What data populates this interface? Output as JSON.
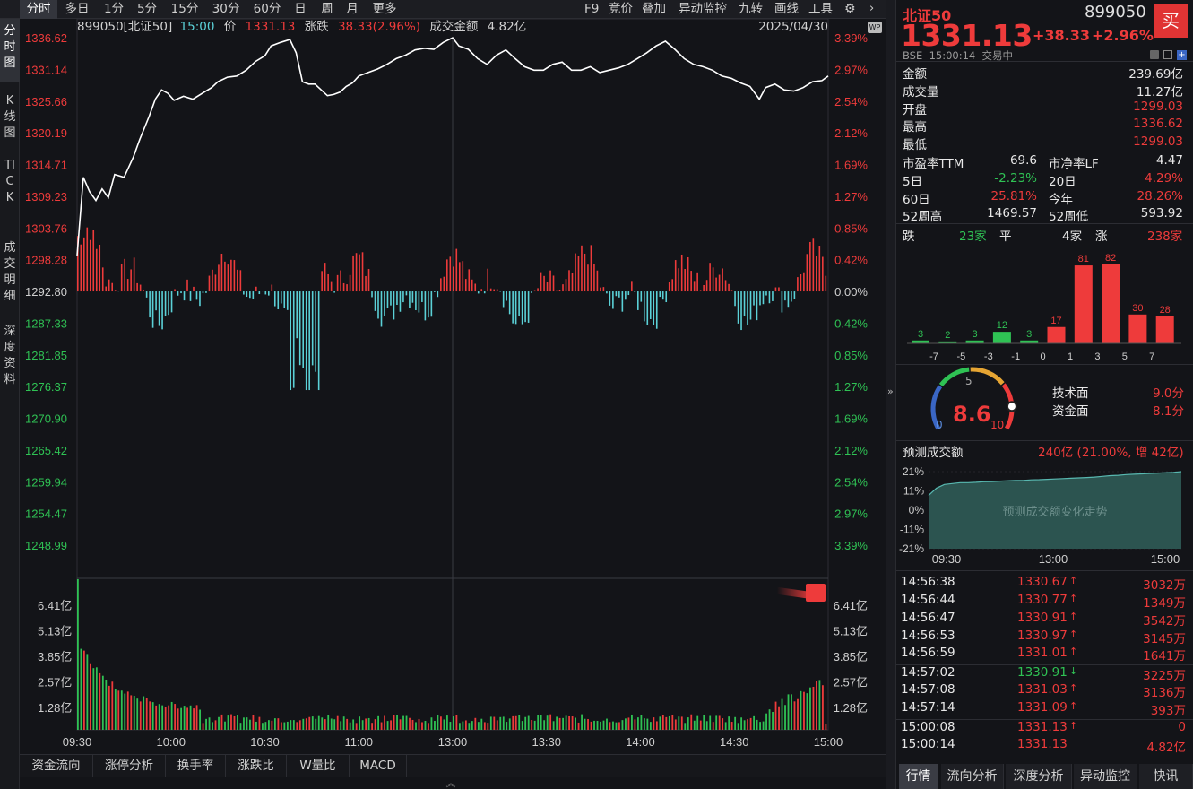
{
  "toolbar": {
    "tabs": [
      "分时",
      "多日",
      "1分",
      "5分",
      "15分",
      "30分",
      "60分",
      "日",
      "周",
      "月",
      "更多"
    ],
    "active_tab": "分时",
    "tools": [
      "F9",
      "竞价",
      "叠加",
      "异动监控",
      "九转",
      "画线",
      "工具"
    ]
  },
  "left_nav": [
    {
      "label": "分时图",
      "active": true
    },
    {
      "label": "K线图",
      "active": false
    },
    {
      "label": "TICK",
      "active": false
    },
    {
      "label": "成交明细",
      "active": false
    },
    {
      "label": "深度资料",
      "active": false
    }
  ],
  "chart_header": {
    "name": "899050[北证50]",
    "time": "15:00",
    "price_label": "价",
    "price": "1331.13",
    "change_label": "涨跌",
    "change": "38.33(2.96%)",
    "amount_label": "成交金额",
    "amount": "4.82亿",
    "date": "2025/04/30",
    "badge": "WP"
  },
  "chart_data": {
    "type": "line",
    "base_price": 1292.8,
    "price_ticks": [
      "1336.62",
      "1331.14",
      "1325.66",
      "1320.19",
      "1314.71",
      "1309.23",
      "1303.76",
      "1298.28",
      "1292.80",
      "1287.33",
      "1281.85",
      "1276.37",
      "1270.90",
      "1265.42",
      "1259.94",
      "1254.47",
      "1248.99"
    ],
    "pct_ticks": [
      "3.39%",
      "2.97%",
      "2.54%",
      "2.12%",
      "1.69%",
      "1.27%",
      "0.85%",
      "0.42%",
      "0.00%",
      "0.42%",
      "0.85%",
      "1.27%",
      "1.69%",
      "2.12%",
      "2.54%",
      "2.97%",
      "3.39%"
    ],
    "volume_ticks": [
      "6.41亿",
      "5.13亿",
      "3.85亿",
      "2.57亿",
      "1.28亿"
    ],
    "time_labels": [
      "09:30",
      "10:00",
      "10:30",
      "11:00",
      "13:00",
      "13:30",
      "14:00",
      "14:30",
      "15:00"
    ],
    "price_line": [
      [
        0,
        1299.0
      ],
      [
        2,
        1312.5
      ],
      [
        4,
        1310.0
      ],
      [
        6,
        1308.5
      ],
      [
        8,
        1310.5
      ],
      [
        10,
        1309.0
      ],
      [
        12,
        1313.0
      ],
      [
        15,
        1312.5
      ],
      [
        18,
        1316.0
      ],
      [
        20,
        1319.0
      ],
      [
        23,
        1323.0
      ],
      [
        25,
        1326.0
      ],
      [
        27,
        1327.6
      ],
      [
        29,
        1327.0
      ],
      [
        31,
        1325.8
      ],
      [
        34,
        1326.5
      ],
      [
        37,
        1326.0
      ],
      [
        40,
        1327.0
      ],
      [
        43,
        1328.0
      ],
      [
        45,
        1329.0
      ],
      [
        48,
        1329.8
      ],
      [
        51,
        1330.0
      ],
      [
        54,
        1331.0
      ],
      [
        57,
        1332.5
      ],
      [
        60,
        1333.5
      ],
      [
        62,
        1335.2
      ],
      [
        65,
        1335.8
      ],
      [
        68,
        1336.3
      ],
      [
        70,
        1334.0
      ],
      [
        72,
        1329.0
      ],
      [
        74,
        1328.6
      ],
      [
        76,
        1328.6
      ],
      [
        78,
        1327.6
      ],
      [
        80,
        1326.6
      ],
      [
        82,
        1326.8
      ],
      [
        84,
        1327.2
      ],
      [
        86,
        1328.2
      ],
      [
        88,
        1328.8
      ],
      [
        90,
        1330.0
      ],
      [
        93,
        1330.6
      ],
      [
        96,
        1331.2
      ],
      [
        99,
        1332.0
      ],
      [
        102,
        1333.0
      ],
      [
        105,
        1333.6
      ],
      [
        108,
        1334.5
      ],
      [
        111,
        1334.8
      ],
      [
        114,
        1334.6
      ],
      [
        117,
        1335.8
      ],
      [
        120,
        1336.6
      ],
      [
        122,
        1335.2
      ],
      [
        125,
        1334.6
      ],
      [
        128,
        1333.0
      ],
      [
        131,
        1332.0
      ],
      [
        134,
        1333.6
      ],
      [
        137,
        1334.5
      ],
      [
        140,
        1333.0
      ],
      [
        143,
        1331.6
      ],
      [
        146,
        1331.0
      ],
      [
        149,
        1331.0
      ],
      [
        152,
        1332.0
      ],
      [
        155,
        1332.4
      ],
      [
        158,
        1331.0
      ],
      [
        161,
        1331.0
      ],
      [
        164,
        1331.6
      ],
      [
        167,
        1330.6
      ],
      [
        170,
        1331.0
      ],
      [
        173,
        1331.4
      ],
      [
        176,
        1332.0
      ],
      [
        179,
        1333.0
      ],
      [
        182,
        1334.0
      ],
      [
        185,
        1335.2
      ],
      [
        188,
        1336.0
      ],
      [
        191,
        1334.6
      ],
      [
        194,
        1333.0
      ],
      [
        197,
        1332.0
      ],
      [
        200,
        1331.6
      ],
      [
        203,
        1331.0
      ],
      [
        206,
        1330.0
      ],
      [
        209,
        1329.6
      ],
      [
        212,
        1328.8
      ],
      [
        215,
        1328.2
      ],
      [
        218,
        1326.0
      ],
      [
        220,
        1328.0
      ],
      [
        223,
        1328.6
      ],
      [
        226,
        1327.6
      ],
      [
        229,
        1327.4
      ],
      [
        232,
        1328.0
      ],
      [
        235,
        1329.0
      ],
      [
        238,
        1329.2
      ],
      [
        240,
        1330.0
      ]
    ],
    "volume_max": 7.69
  },
  "quote": {
    "name": "北证50",
    "code": "899050",
    "buy_label": "买",
    "price": "1331.13",
    "change": "+38.33",
    "change_pct": "+2.96%",
    "sub_info": "BSE  15:00:14  交易中",
    "stats": [
      {
        "label": "金额",
        "value": "239.69亿",
        "color": "#e8e8e8"
      },
      {
        "label": "成交量",
        "value": "11.27亿",
        "color": "#e8e8e8"
      },
      {
        "label": "开盘",
        "value": "1299.03",
        "color": "#ee3b3b"
      },
      {
        "label": "最高",
        "value": "1336.62",
        "color": "#ee3b3b"
      },
      {
        "label": "最低",
        "value": "1299.03",
        "color": "#ee3b3b"
      }
    ],
    "grid": [
      {
        "l1": "市盈率TTM",
        "v1": "69.6",
        "c1": "#e8e8e8",
        "l2": "市净率LF",
        "v2": "4.47",
        "c2": "#e8e8e8"
      },
      {
        "l1": "5日",
        "v1": "-2.23%",
        "c1": "#2fc254",
        "l2": "20日",
        "v2": "4.29%",
        "c2": "#ee3b3b"
      },
      {
        "l1": "60日",
        "v1": "25.81%",
        "c1": "#ee3b3b",
        "l2": "今年",
        "v2": "28.26%",
        "c2": "#ee3b3b"
      },
      {
        "l1": "52周高",
        "v1": "1469.57",
        "c1": "#e8e8e8",
        "l2": "52周低",
        "v2": "593.92",
        "c2": "#e8e8e8"
      }
    ],
    "breadth": {
      "down_label": "跌",
      "down": "23家",
      "flat_label": "平",
      "flat": "4家",
      "up_label": "涨",
      "up": "238家"
    }
  },
  "distribution": {
    "labels": [
      "-7",
      "-5",
      "-3",
      "-1",
      "0",
      "1",
      "3",
      "5",
      "7"
    ],
    "values": [
      3,
      2,
      3,
      12,
      3,
      17,
      81,
      82,
      30,
      28
    ],
    "colors": [
      "#2fc254",
      "#2fc254",
      "#2fc254",
      "#2fc254",
      "#2fc254",
      "#ee3b3b",
      "#ee3b3b",
      "#ee3b3b",
      "#ee3b3b",
      "#ee3b3b"
    ]
  },
  "gauge": {
    "score": "8.6",
    "score_value": 8.6,
    "min": "0",
    "mid": "5",
    "max": "10",
    "tech_label": "技术面",
    "tech_value": "9.0分",
    "fund_label": "资金面",
    "fund_value": "8.1分"
  },
  "forecast": {
    "label": "预测成交额",
    "value": "240亿 (21.00%, 增 42亿)",
    "y_ticks": [
      "21%",
      "11%",
      "0%",
      "-11%",
      "-21%"
    ],
    "x_ticks": [
      "09:30",
      "13:00",
      "15:00"
    ],
    "watermark": "预测成交额变化走势",
    "series_pct": [
      8,
      12,
      14,
      14.5,
      15,
      15,
      15.2,
      15.5,
      15.6,
      15.8,
      16,
      16.2,
      16.2,
      16.5,
      16.6,
      16.8,
      17,
      17.2,
      17.4,
      17.6,
      17.8,
      18,
      18.4,
      18.8,
      19,
      19.4,
      19.6,
      19.8,
      20,
      20.2,
      20.4,
      20.6,
      21
    ]
  },
  "trades": [
    {
      "time": "14:56:38",
      "price": "1330.67",
      "dir": "up",
      "vol": "3032万"
    },
    {
      "time": "14:56:44",
      "price": "1330.77",
      "dir": "up",
      "vol": "1349万"
    },
    {
      "time": "14:56:47",
      "price": "1330.91",
      "dir": "up",
      "vol": "3542万"
    },
    {
      "time": "14:56:53",
      "price": "1330.97",
      "dir": "up",
      "vol": "3145万"
    },
    {
      "time": "14:56:59",
      "price": "1331.01",
      "dir": "up",
      "vol": "1641万"
    },
    {
      "time": "14:57:02",
      "price": "1330.91",
      "dir": "down",
      "vol": "3225万"
    },
    {
      "time": "14:57:08",
      "price": "1331.03",
      "dir": "up",
      "vol": "3136万"
    },
    {
      "time": "14:57:14",
      "price": "1331.09",
      "dir": "up",
      "vol": "393万"
    },
    {
      "time": "15:00:08",
      "price": "1331.13",
      "dir": "up",
      "vol": "0"
    },
    {
      "time": "15:00:14",
      "price": "1331.13",
      "dir": "none",
      "vol": "4.82亿"
    }
  ],
  "bottom_tabs": [
    "资金流向",
    "涨停分析",
    "换手率",
    "涨跌比",
    "W量比",
    "MACD"
  ],
  "right_tabs": [
    "行情",
    "流向分析",
    "深度分析",
    "异动监控",
    "快讯"
  ],
  "right_active_tab": "行情",
  "colors": {
    "up": "#ee3b3b",
    "down": "#2fc254",
    "line": "#ffffff",
    "cyan": "#5bd1d7",
    "bg": "#131418"
  }
}
